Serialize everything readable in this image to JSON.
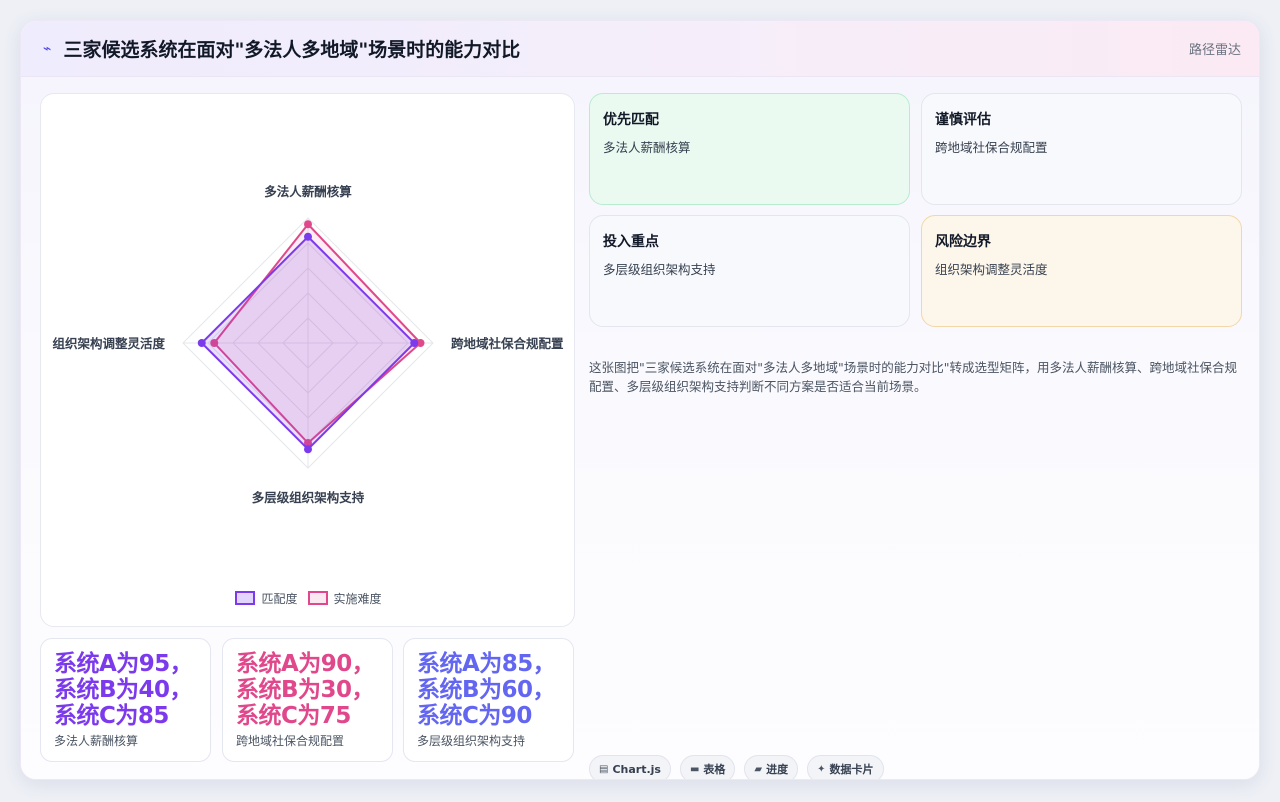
{
  "header": {
    "icon": "bolt-icon",
    "title": "三家候选系统在面对\"多法人多地域\"场景时的能力对比",
    "tag": "路径雷达"
  },
  "chart_data": {
    "type": "radar",
    "axes": [
      "多法人薪酬核算",
      "跨地域社保合规配置",
      "多层级组织架构支持",
      "组织架构调整灵活度"
    ],
    "range": [
      0,
      100
    ],
    "series": [
      {
        "name": "匹配度",
        "color": "#7c3aed",
        "values": [
          85,
          85,
          85,
          85
        ]
      },
      {
        "name": "实施难度",
        "color": "#e0488b",
        "values": [
          95,
          90,
          80,
          75
        ]
      }
    ],
    "legend_position": "bottom"
  },
  "stats": [
    {
      "value": "系统A为95，系统B为40，系统C为85",
      "label": "多法人薪酬核算",
      "color": "#7c3aed"
    },
    {
      "value": "系统A为90，系统B为30，系统C为75",
      "label": "跨地域社保合规配置",
      "color": "#e0488b"
    },
    {
      "value": "系统A为85，系统B为60，系统C为90",
      "label": "多层级组织架构支持",
      "color": "#6366f1"
    }
  ],
  "insights": [
    {
      "title": "优先匹配",
      "text": "多法人薪酬核算"
    },
    {
      "title": "谨慎评估",
      "text": "跨地域社保合规配置"
    },
    {
      "title": "投入重点",
      "text": "多层级组织架构支持"
    },
    {
      "title": "风险边界",
      "text": "组织架构调整灵活度"
    }
  ],
  "description": "这张图把\"三家候选系统在面对\"多法人多地域\"场景时的能力对比\"转成选型矩阵，用多法人薪酬核算、跨地域社保合规配置、多层级组织架构支持判断不同方案是否适合当前场景。",
  "pills": [
    {
      "icon": "chart-icon",
      "label": "Chart.js"
    },
    {
      "icon": "table-icon",
      "label": "表格"
    },
    {
      "icon": "progress-icon",
      "label": "进度"
    },
    {
      "icon": "sparkle-icon",
      "label": "数据卡片"
    }
  ]
}
